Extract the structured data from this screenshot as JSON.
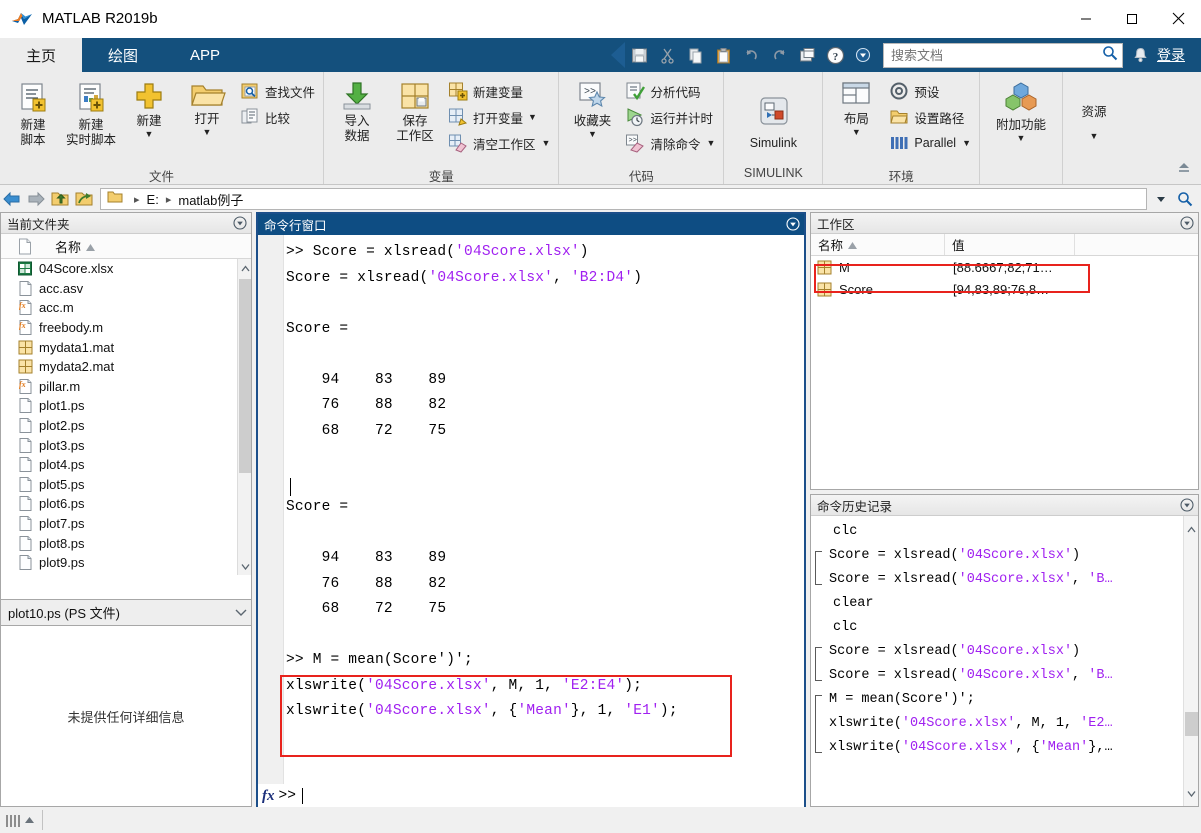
{
  "window": {
    "title": "MATLAB R2019b",
    "minimize_label": "─",
    "maximize_label": "☐",
    "close_label": "✕"
  },
  "tabs": [
    {
      "label": "主页",
      "active": true
    },
    {
      "label": "绘图",
      "active": false
    },
    {
      "label": "APP",
      "active": false
    }
  ],
  "quick_access": {
    "icons": [
      "save-icon",
      "cut-icon",
      "copy-icon",
      "paste-icon",
      "undo-icon",
      "redo-icon",
      "switch-window-icon",
      "help-icon",
      "more-icon"
    ],
    "search_placeholder": "搜索文档",
    "search_value": "",
    "search_icon": "search-icon",
    "bell_icon": "bell-icon",
    "signin_label": "登录"
  },
  "ribbon": {
    "groups": [
      {
        "title": "文件",
        "big_buttons": [
          {
            "label_line1": "新建",
            "label_line2": "脚本",
            "icon": "new-script-icon",
            "has_caret": false
          },
          {
            "label_line1": "新建",
            "label_line2": "实时脚本",
            "icon": "new-live-script-icon",
            "has_caret": false
          },
          {
            "label_line1": "新建",
            "label_line2": "",
            "icon": "new-plus-icon",
            "has_caret": true
          },
          {
            "label_line1": "打开",
            "label_line2": "",
            "icon": "open-folder-icon",
            "has_caret": true
          }
        ],
        "small_buttons": [
          {
            "label": "查找文件",
            "icon": "find-files-icon",
            "has_caret": false
          },
          {
            "label": "比较",
            "icon": "compare-icon",
            "has_caret": false
          }
        ]
      },
      {
        "title": "变量",
        "big_buttons": [
          {
            "label_line1": "导入",
            "label_line2": "数据",
            "icon": "import-data-icon",
            "has_caret": false
          },
          {
            "label_line1": "保存",
            "label_line2": "工作区",
            "icon": "save-workspace-icon",
            "has_caret": false
          }
        ],
        "small_buttons": [
          {
            "label": "新建变量",
            "icon": "new-variable-icon",
            "has_caret": false
          },
          {
            "label": "打开变量",
            "icon": "open-variable-icon",
            "has_caret": true
          },
          {
            "label": "清空工作区",
            "icon": "clear-workspace-icon",
            "has_caret": true
          }
        ]
      },
      {
        "title": "代码",
        "big_buttons": [
          {
            "label_line1": "收藏夹",
            "label_line2": "",
            "icon": "favorites-icon",
            "has_caret": true
          }
        ],
        "small_buttons": [
          {
            "label": "分析代码",
            "icon": "analyze-code-icon",
            "has_caret": false
          },
          {
            "label": "运行并计时",
            "icon": "run-and-time-icon",
            "has_caret": false
          },
          {
            "label": "清除命令",
            "icon": "clear-commands-icon",
            "has_caret": true
          }
        ]
      },
      {
        "title": "SIMULINK",
        "big_buttons": [
          {
            "label_line1": "Simulink",
            "label_line2": "",
            "icon": "simulink-icon",
            "has_caret": false
          }
        ],
        "small_buttons": []
      },
      {
        "title": "环境",
        "big_buttons": [
          {
            "label_line1": "布局",
            "label_line2": "",
            "icon": "layout-icon",
            "has_caret": true
          }
        ],
        "small_buttons": [
          {
            "label": "预设",
            "icon": "preferences-icon",
            "has_caret": false
          },
          {
            "label": "设置路径",
            "icon": "set-path-icon",
            "has_caret": false
          },
          {
            "label": "Parallel",
            "icon": "parallel-icon",
            "has_caret": true
          }
        ]
      },
      {
        "title": "",
        "big_buttons": [
          {
            "label_line1": "附加功能",
            "label_line2": "",
            "icon": "add-ons-icon",
            "has_caret": true
          }
        ],
        "small_buttons": []
      },
      {
        "title": "",
        "big_buttons": [
          {
            "label_line1": "资源",
            "label_line2": "",
            "icon": "resources-icon",
            "has_caret": true
          }
        ],
        "small_buttons": []
      }
    ],
    "collapse_icon": "collapse-ribbon-icon"
  },
  "address_bar": {
    "back_icon": "back-arrow-icon",
    "forward_icon": "forward-arrow-icon",
    "up_icon": "up-folder-icon",
    "browse_icon": "browse-folder-icon",
    "folder_icon": "folder-icon",
    "crumbs": [
      "E:",
      "matlab例子"
    ],
    "dropdown_icon": "chevron-down-icon",
    "search_icon": "search-icon"
  },
  "current_folder": {
    "title": "当前文件夹",
    "panel_menu_icon": "panel-menu-icon",
    "columns": [
      "名称"
    ],
    "sort_icon": "sort-ascending-icon",
    "files": [
      {
        "name": "04Score.xlsx",
        "icon": "excel-file-icon"
      },
      {
        "name": "acc.asv",
        "icon": "generic-file-icon"
      },
      {
        "name": "acc.m",
        "icon": "matlab-file-icon"
      },
      {
        "name": "freebody.m",
        "icon": "matlab-file-icon"
      },
      {
        "name": "mydata1.mat",
        "icon": "mat-file-icon"
      },
      {
        "name": "mydata2.mat",
        "icon": "mat-file-icon"
      },
      {
        "name": "pillar.m",
        "icon": "matlab-file-icon"
      },
      {
        "name": "plot1.ps",
        "icon": "generic-file-icon"
      },
      {
        "name": "plot2.ps",
        "icon": "generic-file-icon"
      },
      {
        "name": "plot3.ps",
        "icon": "generic-file-icon"
      },
      {
        "name": "plot4.ps",
        "icon": "generic-file-icon"
      },
      {
        "name": "plot5.ps",
        "icon": "generic-file-icon"
      },
      {
        "name": "plot6.ps",
        "icon": "generic-file-icon"
      },
      {
        "name": "plot7.ps",
        "icon": "generic-file-icon"
      },
      {
        "name": "plot8.ps",
        "icon": "generic-file-icon"
      },
      {
        "name": "plot9.ps",
        "icon": "generic-file-icon"
      }
    ],
    "detail_header": "plot10.ps  (PS 文件)",
    "detail_message": "未提供任何详细信息"
  },
  "command_window": {
    "title": "命令行窗口",
    "panel_menu_icon": "panel-menu-icon",
    "lines": [
      {
        "segments": [
          {
            "t": ">> Score = xlsread(",
            "c": "k"
          },
          {
            "t": "'04Score.xlsx'",
            "c": "s"
          },
          {
            "t": ")",
            "c": "k"
          }
        ]
      },
      {
        "segments": [
          {
            "t": "Score = xlsread(",
            "c": "k"
          },
          {
            "t": "'04Score.xlsx'",
            "c": "s"
          },
          {
            "t": ", ",
            "c": "k"
          },
          {
            "t": "'B2:D4'",
            "c": "s"
          },
          {
            "t": ")",
            "c": "k"
          }
        ]
      },
      {
        "segments": []
      },
      {
        "segments": [
          {
            "t": "Score =",
            "c": "k"
          }
        ]
      },
      {
        "segments": []
      },
      {
        "segments": [
          {
            "t": "    94    83    89",
            "c": "k"
          }
        ]
      },
      {
        "segments": [
          {
            "t": "    76    88    82",
            "c": "k"
          }
        ]
      },
      {
        "segments": [
          {
            "t": "    68    72    75",
            "c": "k"
          }
        ]
      },
      {
        "segments": []
      },
      {
        "segments": []
      },
      {
        "segments": [
          {
            "t": "Score =",
            "c": "k"
          }
        ]
      },
      {
        "segments": []
      },
      {
        "segments": [
          {
            "t": "    94    83    89",
            "c": "k"
          }
        ]
      },
      {
        "segments": [
          {
            "t": "    76    88    82",
            "c": "k"
          }
        ]
      },
      {
        "segments": [
          {
            "t": "    68    72    75",
            "c": "k"
          }
        ]
      },
      {
        "segments": []
      },
      {
        "segments": [
          {
            "t": ">> M = mean(Score')';",
            "c": "k"
          }
        ]
      },
      {
        "segments": [
          {
            "t": "xlswrite(",
            "c": "k"
          },
          {
            "t": "'04Score.xlsx'",
            "c": "s"
          },
          {
            "t": ", M, 1, ",
            "c": "k"
          },
          {
            "t": "'E2:E4'",
            "c": "s"
          },
          {
            "t": ");",
            "c": "k"
          }
        ]
      },
      {
        "segments": [
          {
            "t": "xlswrite(",
            "c": "k"
          },
          {
            "t": "'04Score.xlsx'",
            "c": "s"
          },
          {
            "t": ", {",
            "c": "k"
          },
          {
            "t": "'Mean'",
            "c": "s"
          },
          {
            "t": "}, 1, ",
            "c": "k"
          },
          {
            "t": "'E1'",
            "c": "s"
          },
          {
            "t": ");",
            "c": "k"
          }
        ]
      }
    ],
    "prompt": ">>",
    "prompt_icon": "fx-icon",
    "highlight_color": "#e8231d"
  },
  "workspace": {
    "title": "工作区",
    "panel_menu_icon": "panel-menu-icon",
    "columns": [
      "名称",
      "值",
      ""
    ],
    "sort_icon": "sort-ascending-icon",
    "rows": [
      {
        "name": "M",
        "value": "[88.6667;82;71…",
        "icon": "matrix-icon",
        "highlighted": true
      },
      {
        "name": "Score",
        "value": "[94,83,89;76,8…",
        "icon": "matrix-icon",
        "highlighted": false
      }
    ],
    "highlight_color": "#e8231d"
  },
  "command_history": {
    "title": "命令历史记录",
    "panel_menu_icon": "panel-menu-icon",
    "entries": [
      {
        "segments": [
          {
            "t": "clc",
            "c": "k"
          }
        ],
        "group": "none"
      },
      {
        "segments": [
          {
            "t": "Score = xlsread(",
            "c": "k"
          },
          {
            "t": "'04Score.xlsx'",
            "c": "s"
          },
          {
            "t": ")",
            "c": "k"
          }
        ],
        "group": "start"
      },
      {
        "segments": [
          {
            "t": "Score = xlsread(",
            "c": "k"
          },
          {
            "t": "'04Score.xlsx'",
            "c": "s"
          },
          {
            "t": ", ",
            "c": "k"
          },
          {
            "t": "'B…",
            "c": "s"
          }
        ],
        "group": "end"
      },
      {
        "segments": [
          {
            "t": "clear",
            "c": "k"
          }
        ],
        "group": "none"
      },
      {
        "segments": [
          {
            "t": "clc",
            "c": "k"
          }
        ],
        "group": "none"
      },
      {
        "segments": [
          {
            "t": "Score = xlsread(",
            "c": "k"
          },
          {
            "t": "'04Score.xlsx'",
            "c": "s"
          },
          {
            "t": ")",
            "c": "k"
          }
        ],
        "group": "start"
      },
      {
        "segments": [
          {
            "t": "Score = xlsread(",
            "c": "k"
          },
          {
            "t": "'04Score.xlsx'",
            "c": "s"
          },
          {
            "t": ", ",
            "c": "k"
          },
          {
            "t": "'B…",
            "c": "s"
          }
        ],
        "group": "end"
      },
      {
        "segments": [
          {
            "t": "M = mean(Score')';",
            "c": "k"
          }
        ],
        "group": "start"
      },
      {
        "segments": [
          {
            "t": "xlswrite(",
            "c": "k"
          },
          {
            "t": "'04Score.xlsx'",
            "c": "s"
          },
          {
            "t": ", M, 1, ",
            "c": "k"
          },
          {
            "t": "'E2…",
            "c": "s"
          }
        ],
        "group": "mid"
      },
      {
        "segments": [
          {
            "t": "xlswrite(",
            "c": "k"
          },
          {
            "t": "'04Score.xlsx'",
            "c": "s"
          },
          {
            "t": ", {",
            "c": "k"
          },
          {
            "t": "'Mean'",
            "c": "s"
          },
          {
            "t": "},…",
            "c": "k"
          }
        ],
        "group": "end"
      }
    ],
    "scroll_up_icon": "chevron-up-icon",
    "scroll_down_icon": "chevron-down-icon"
  },
  "status_bar": {
    "grip_icon": "resize-grip-icon"
  },
  "colors": {
    "titlebar_blue": "#14507d",
    "panel_header_blue": "#0e4d83",
    "ribbon_bg": "#ececec",
    "highlight_red": "#e8231d",
    "string_purple": "#a020f0"
  }
}
